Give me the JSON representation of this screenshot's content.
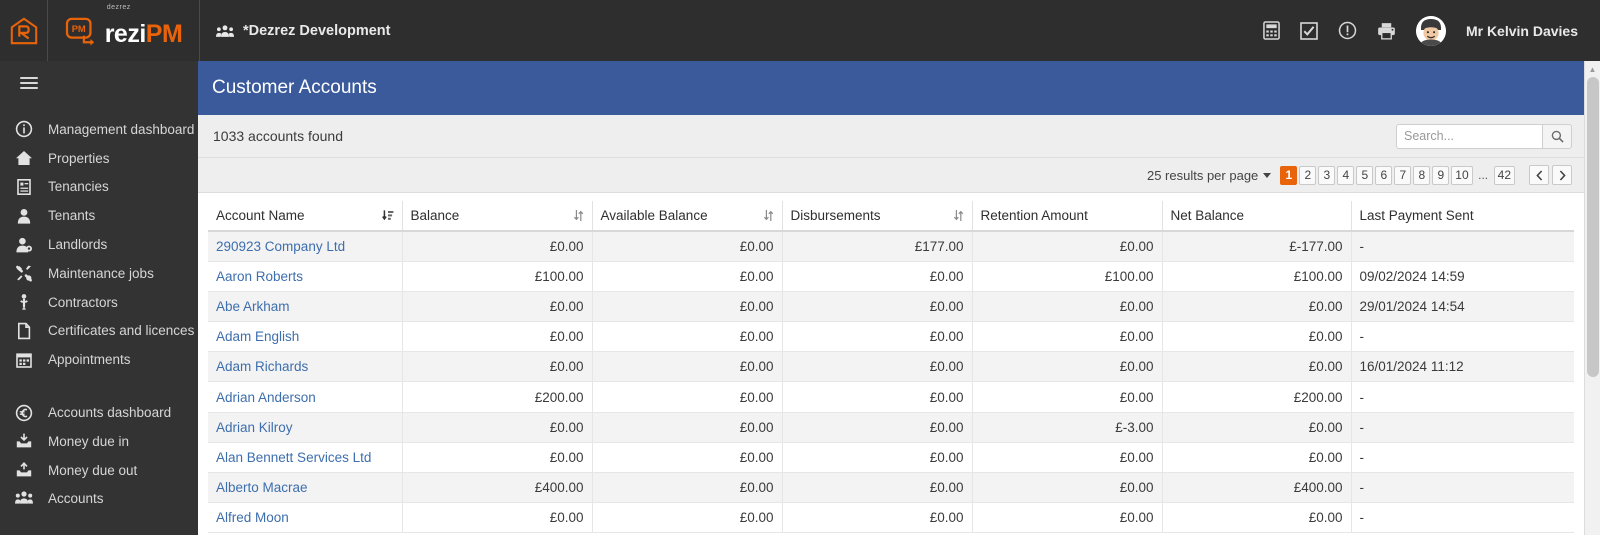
{
  "topbar": {
    "brand_icon": "rezi-house-r-icon",
    "logo_sup": "dezrez",
    "logo_main": "rezi",
    "logo_accent": "PM",
    "org_icon": "group-people-icon",
    "org_name": "*Dezrez Development",
    "icons": [
      {
        "name": "calculator-icon"
      },
      {
        "name": "checkbox-checked-icon"
      },
      {
        "name": "exclamation-circle-icon"
      },
      {
        "name": "printer-icon"
      }
    ],
    "avatar_name": "user-avatar",
    "username": "Mr Kelvin Davies"
  },
  "sidebar": {
    "toggle_label": "menu-toggle",
    "groups": [
      {
        "items": [
          {
            "label": "Management dashboard",
            "icon": "info-circle-icon",
            "key": "management-dashboard"
          },
          {
            "label": "Properties",
            "icon": "home-icon",
            "key": "properties"
          },
          {
            "label": "Tenancies",
            "icon": "document-list-icon",
            "key": "tenancies"
          },
          {
            "label": "Tenants",
            "icon": "user-icon",
            "key": "tenants"
          },
          {
            "label": "Landlords",
            "icon": "user-gear-icon",
            "key": "landlords"
          },
          {
            "label": "Maintenance jobs",
            "icon": "tools-icon",
            "key": "maintenance-jobs"
          },
          {
            "label": "Contractors",
            "icon": "wrench-person-icon",
            "key": "contractors"
          },
          {
            "label": "Certificates and licences",
            "icon": "file-icon",
            "key": "certificates-and-licences"
          },
          {
            "label": "Appointments",
            "icon": "calendar-icon",
            "key": "appointments"
          }
        ]
      },
      {
        "items": [
          {
            "label": "Accounts dashboard",
            "icon": "euro-circle-icon",
            "key": "accounts-dashboard"
          },
          {
            "label": "Money due in",
            "icon": "inbox-in-icon",
            "key": "money-due-in"
          },
          {
            "label": "Money due out",
            "icon": "inbox-out-icon",
            "key": "money-due-out"
          },
          {
            "label": "Accounts",
            "icon": "group-people-icon",
            "key": "accounts"
          }
        ]
      }
    ]
  },
  "page": {
    "title": "Customer Accounts",
    "result_count_text": "1033 accounts found"
  },
  "search": {
    "placeholder": "Search...",
    "value": "",
    "button_icon": "search-icon"
  },
  "pagination": {
    "per_page_label": "25 results per page",
    "pages": [
      "1",
      "2",
      "3",
      "4",
      "5",
      "6",
      "7",
      "8",
      "9",
      "10"
    ],
    "ellipsis": "...",
    "last_page": "42",
    "active_page": "1",
    "prev_icon": "chevron-left-icon",
    "next_icon": "chevron-right-icon",
    "active_color": "#e8630a"
  },
  "table": {
    "columns": [
      {
        "label": "Account Name",
        "align": "left",
        "sort": "active-desc"
      },
      {
        "label": "Balance",
        "align": "right",
        "sort": "neutral"
      },
      {
        "label": "Available Balance",
        "align": "right",
        "sort": "neutral"
      },
      {
        "label": "Disbursements",
        "align": "right",
        "sort": "neutral"
      },
      {
        "label": "Retention Amount",
        "align": "right",
        "sort": "none"
      },
      {
        "label": "Net Balance",
        "align": "right",
        "sort": "none"
      },
      {
        "label": "Last Payment Sent",
        "align": "left",
        "sort": "none"
      }
    ],
    "rows": [
      {
        "name": "290923 Company Ltd",
        "balance": "£0.00",
        "available": "£0.00",
        "disbursements": "£177.00",
        "retention": "£0.00",
        "net": "£-177.00",
        "last_payment": "-"
      },
      {
        "name": "Aaron Roberts",
        "balance": "£100.00",
        "available": "£0.00",
        "disbursements": "£0.00",
        "retention": "£100.00",
        "net": "£100.00",
        "last_payment": "09/02/2024 14:59"
      },
      {
        "name": "Abe Arkham",
        "balance": "£0.00",
        "available": "£0.00",
        "disbursements": "£0.00",
        "retention": "£0.00",
        "net": "£0.00",
        "last_payment": "29/01/2024 14:54"
      },
      {
        "name": "Adam English",
        "balance": "£0.00",
        "available": "£0.00",
        "disbursements": "£0.00",
        "retention": "£0.00",
        "net": "£0.00",
        "last_payment": "-"
      },
      {
        "name": "Adam Richards",
        "balance": "£0.00",
        "available": "£0.00",
        "disbursements": "£0.00",
        "retention": "£0.00",
        "net": "£0.00",
        "last_payment": "16/01/2024 11:12"
      },
      {
        "name": "Adrian Anderson",
        "balance": "£200.00",
        "available": "£0.00",
        "disbursements": "£0.00",
        "retention": "£0.00",
        "net": "£200.00",
        "last_payment": "-"
      },
      {
        "name": "Adrian Kilroy",
        "balance": "£0.00",
        "available": "£0.00",
        "disbursements": "£0.00",
        "retention": "£-3.00",
        "net": "£0.00",
        "last_payment": "-"
      },
      {
        "name": "Alan Bennett Services Ltd",
        "balance": "£0.00",
        "available": "£0.00",
        "disbursements": "£0.00",
        "retention": "£0.00",
        "net": "£0.00",
        "last_payment": "-"
      },
      {
        "name": "Alberto Macrae",
        "balance": "£400.00",
        "available": "£0.00",
        "disbursements": "£0.00",
        "retention": "£0.00",
        "net": "£400.00",
        "last_payment": "-"
      },
      {
        "name": "Alfred Moon",
        "balance": "£0.00",
        "available": "£0.00",
        "disbursements": "£0.00",
        "retention": "£0.00",
        "net": "£0.00",
        "last_payment": "-"
      }
    ]
  },
  "scrollbar": {
    "up_icon": "scroll-up-icon",
    "down_icon": "scroll-down-icon"
  }
}
